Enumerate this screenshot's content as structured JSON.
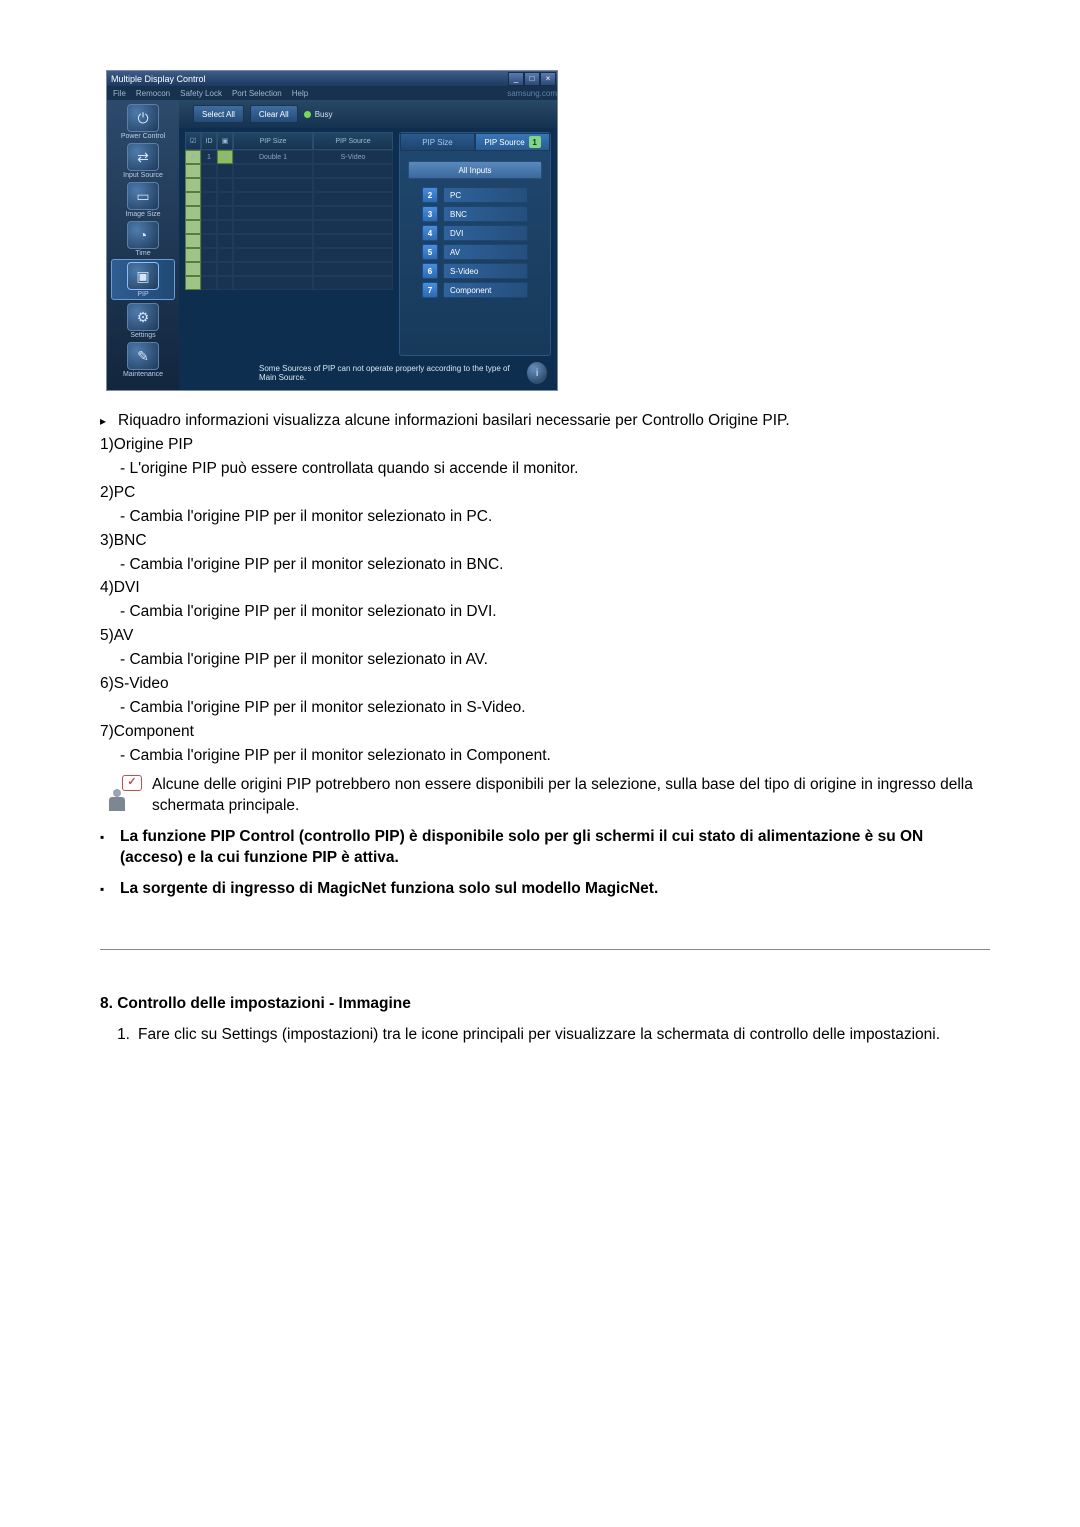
{
  "app": {
    "title": "Multiple Display Control",
    "menus": [
      "File",
      "Remocon",
      "Safety Lock",
      "Port Selection",
      "Help"
    ],
    "brand": "samsung.com",
    "win_buttons": {
      "minimize": "_",
      "maximize": "□",
      "close": "×"
    }
  },
  "sidebar": {
    "items": [
      {
        "label": "Power Control",
        "glyph": "⏻"
      },
      {
        "label": "Input Source",
        "glyph": "⇄"
      },
      {
        "label": "Image Size",
        "glyph": "▭"
      },
      {
        "label": "Time",
        "glyph": "◔"
      },
      {
        "label": "PIP",
        "glyph": "▣",
        "active": true
      },
      {
        "label": "Settings",
        "glyph": "⚙"
      },
      {
        "label": "Maintenance",
        "glyph": "✎"
      }
    ]
  },
  "toolbar": {
    "select_all": "Select All",
    "clear_all": "Clear All",
    "busy": "Busy"
  },
  "grid": {
    "headers": {
      "chk": "☑",
      "id": "ID",
      "pwr": "▣",
      "size": "PIP Size",
      "source": "PIP Source"
    },
    "row2": {
      "id": "1",
      "size": "Double 1",
      "source": "S-Video"
    },
    "empty_rows": 9
  },
  "right": {
    "tab_size": "PIP Size",
    "tab_source": "PIP Source",
    "badge": "1",
    "all_inputs": "All Inputs",
    "sources": [
      {
        "n": "2",
        "label": "PC"
      },
      {
        "n": "3",
        "label": "BNC"
      },
      {
        "n": "4",
        "label": "DVI"
      },
      {
        "n": "5",
        "label": "AV"
      },
      {
        "n": "6",
        "label": "S-Video"
      },
      {
        "n": "7",
        "label": "Component"
      }
    ]
  },
  "footer_note": "Some Sources of PIP can not operate properly according to the type of Main Source.",
  "info_glyph": "i",
  "doc": {
    "intro": "Riquadro informazioni visualizza alcune informazioni basilari necessarie per Controllo Origine PIP.",
    "items": [
      {
        "num": "1) ",
        "label": "Origine PIP",
        "desc": "- L'origine PIP può essere controllata quando si accende il monitor."
      },
      {
        "num": "2) ",
        "label": "PC",
        "desc": "- Cambia l'origine PIP per il monitor selezionato in PC."
      },
      {
        "num": "3) ",
        "label": "BNC",
        "desc": "- Cambia l'origine PIP per il monitor selezionato in BNC."
      },
      {
        "num": "4) ",
        "label": "DVI",
        "desc": "- Cambia l'origine PIP per il monitor selezionato in DVI."
      },
      {
        "num": "5) ",
        "label": "AV",
        "desc": "- Cambia l'origine PIP per il monitor selezionato in AV."
      },
      {
        "num": "6) ",
        "label": "S-Video",
        "desc": "- Cambia l'origine PIP per il monitor selezionato in S-Video."
      },
      {
        "num": "7) ",
        "label": "Component",
        "desc": "- Cambia l'origine PIP per il monitor selezionato in Component."
      }
    ],
    "note": "Alcune delle origini PIP potrebbero non essere disponibili per la selezione, sulla base del tipo di origine in ingresso della schermata principale.",
    "bold1": "La funzione PIP Control (controllo PIP) è disponibile solo per gli schermi il cui stato di alimentazione è su ON (acceso) e la cui funzione PIP è attiva.",
    "bold2": "La sorgente di ingresso di MagicNet funziona solo sul modello MagicNet.",
    "section": "8. Controllo delle impostazioni - Immagine",
    "step1_num": "1.",
    "step1": "Fare clic su Settings (impostazioni) tra le icone principali per visualizzare la schermata di controllo delle impostazioni."
  },
  "glyphs": {
    "arrow": "▸",
    "bullet": "▪",
    "check": "✓"
  }
}
